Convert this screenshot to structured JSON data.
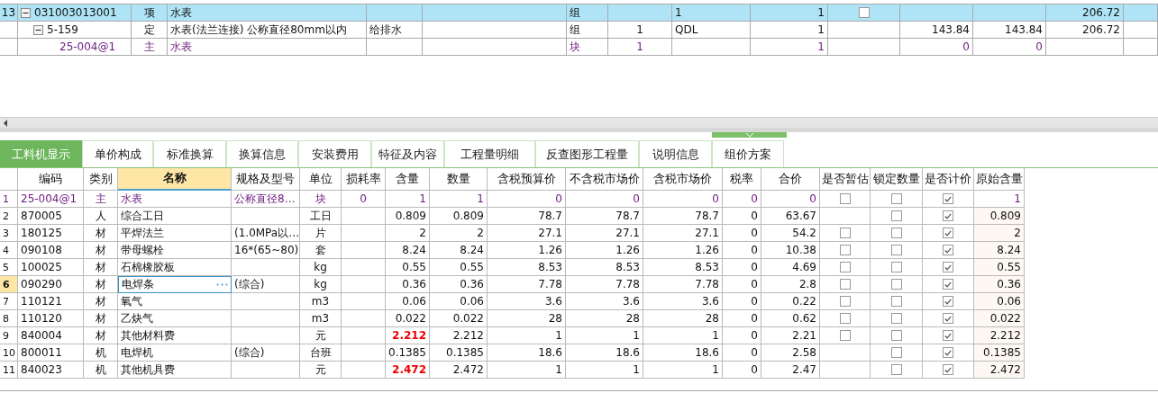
{
  "top_table": {
    "rows": [
      {
        "row_number": "13",
        "code": "031003013001",
        "type": "项",
        "name": "水表",
        "unit": "组",
        "column_9": "1",
        "column_10": "1",
        "column_11": false,
        "column_14": "206.72",
        "selected": true,
        "expanded": true,
        "children": [
          {
            "code": "5-159",
            "type": "定",
            "name": "水表(法兰连接) 公称直径80mm以内",
            "column_5": "给排水",
            "unit": "组",
            "column_8": "1",
            "column_9": "QDL",
            "column_10": "1",
            "column_12": "143.84",
            "column_13": "143.84",
            "column_14": "206.72",
            "selected": false,
            "expanded": true,
            "children": [
              {
                "code": "25-004@1",
                "type": "主",
                "name": "水表",
                "unit": "块",
                "column_8": "1",
                "column_10": "1",
                "column_12": "0",
                "column_13": "0",
                "kind": "main",
                "selected": false
              }
            ]
          }
        ]
      }
    ]
  },
  "tabs": [
    {
      "label": "工料机显示",
      "selected": true
    },
    {
      "label": "单价构成",
      "selected": false
    },
    {
      "label": "标准换算",
      "selected": false
    },
    {
      "label": "换算信息",
      "selected": false
    },
    {
      "label": "安装费用",
      "selected": false
    },
    {
      "label": "特征及内容",
      "selected": false
    },
    {
      "label": "工程量明细",
      "selected": false
    },
    {
      "label": "反查图形工程量",
      "selected": false
    },
    {
      "label": "说明信息",
      "selected": false
    },
    {
      "label": "组价方案",
      "selected": false
    }
  ],
  "resource_table": {
    "columns": [
      {
        "label": "编码",
        "selected": false
      },
      {
        "label": "类别",
        "selected": false
      },
      {
        "label": "名称",
        "selected": true
      },
      {
        "label": "规格及型号",
        "selected": false
      },
      {
        "label": "单位",
        "selected": false
      },
      {
        "label": "损耗率",
        "selected": false
      },
      {
        "label": "含量",
        "selected": false
      },
      {
        "label": "数量",
        "selected": false
      },
      {
        "label": "含税预算价",
        "selected": false
      },
      {
        "label": "不含税市场价",
        "selected": false
      },
      {
        "label": "含税市场价",
        "selected": false
      },
      {
        "label": "税率",
        "selected": false
      },
      {
        "label": "合价",
        "selected": false
      },
      {
        "label": "是否暂估",
        "selected": false
      },
      {
        "label": "锁定数量",
        "selected": false
      },
      {
        "label": "是否计价",
        "selected": false
      },
      {
        "label": "原始含量",
        "selected": false
      }
    ],
    "rows": [
      {
        "number": "1",
        "code": "25-004@1",
        "category": "主",
        "name": "水表",
        "spec": "公称直径8…",
        "unit": "块",
        "loss_rate": "0",
        "content": "1",
        "quantity": "1",
        "budget_price": "0",
        "market_price_ex_tax": "0",
        "market_price": "0",
        "tax_rate": "0",
        "total": "0",
        "provisional": false,
        "locked": false,
        "priced": true,
        "original_content": "1",
        "kind": "main",
        "content_highlight": false,
        "selected": false
      },
      {
        "number": "2",
        "code": "870005",
        "category": "人",
        "name": "综合工日",
        "unit": "工日",
        "content": "0.809",
        "quantity": "0.809",
        "budget_price": "78.7",
        "market_price_ex_tax": "78.7",
        "market_price": "78.7",
        "tax_rate": "0",
        "total": "63.67",
        "locked": false,
        "priced": true,
        "original_content": "0.809",
        "kind": "normal",
        "content_highlight": false,
        "selected": false
      },
      {
        "number": "3",
        "code": "180125",
        "category": "材",
        "name": "平焊法兰",
        "spec": "(1.0MPa以…",
        "unit": "片",
        "content": "2",
        "quantity": "2",
        "budget_price": "27.1",
        "market_price_ex_tax": "27.1",
        "market_price": "27.1",
        "tax_rate": "0",
        "total": "54.2",
        "provisional": false,
        "locked": false,
        "priced": true,
        "original_content": "2",
        "kind": "normal",
        "content_highlight": false,
        "selected": false
      },
      {
        "number": "4",
        "code": "090108",
        "category": "材",
        "name": "带母螺栓",
        "spec": "16*(65~80)",
        "unit": "套",
        "content": "8.24",
        "quantity": "8.24",
        "budget_price": "1.26",
        "market_price_ex_tax": "1.26",
        "market_price": "1.26",
        "tax_rate": "0",
        "total": "10.38",
        "provisional": false,
        "locked": false,
        "priced": true,
        "original_content": "8.24",
        "kind": "normal",
        "content_highlight": false,
        "selected": false
      },
      {
        "number": "5",
        "code": "100025",
        "category": "材",
        "name": "石棉橡胶板",
        "unit": "kg",
        "content": "0.55",
        "quantity": "0.55",
        "budget_price": "8.53",
        "market_price_ex_tax": "8.53",
        "market_price": "8.53",
        "tax_rate": "0",
        "total": "4.69",
        "provisional": false,
        "locked": false,
        "priced": true,
        "original_content": "0.55",
        "kind": "normal",
        "content_highlight": false,
        "selected": false
      },
      {
        "number": "6",
        "code": "090290",
        "category": "材",
        "name": "电焊条",
        "spec": "(综合)",
        "unit": "kg",
        "content": "0.36",
        "quantity": "0.36",
        "budget_price": "7.78",
        "market_price_ex_tax": "7.78",
        "market_price": "7.78",
        "tax_rate": "0",
        "total": "2.8",
        "provisional": false,
        "locked": false,
        "priced": true,
        "original_content": "0.36",
        "kind": "normal",
        "content_highlight": false,
        "selected": true
      },
      {
        "number": "7",
        "code": "110121",
        "category": "材",
        "name": "氧气",
        "unit": "m3",
        "content": "0.06",
        "quantity": "0.06",
        "budget_price": "3.6",
        "market_price_ex_tax": "3.6",
        "market_price": "3.6",
        "tax_rate": "0",
        "total": "0.22",
        "provisional": false,
        "locked": false,
        "priced": true,
        "original_content": "0.06",
        "kind": "normal",
        "content_highlight": false,
        "selected": false
      },
      {
        "number": "8",
        "code": "110120",
        "category": "材",
        "name": "乙炔气",
        "unit": "m3",
        "content": "0.022",
        "quantity": "0.022",
        "budget_price": "28",
        "market_price_ex_tax": "28",
        "market_price": "28",
        "tax_rate": "0",
        "total": "0.62",
        "provisional": false,
        "locked": false,
        "priced": true,
        "original_content": "0.022",
        "kind": "normal",
        "content_highlight": false,
        "selected": false
      },
      {
        "number": "9",
        "code": "840004",
        "category": "材",
        "name": "其他材料费",
        "unit": "元",
        "content": "2.212",
        "quantity": "2.212",
        "budget_price": "1",
        "market_price_ex_tax": "1",
        "market_price": "1",
        "tax_rate": "0",
        "total": "2.21",
        "provisional": false,
        "locked": false,
        "priced": true,
        "original_content": "2.212",
        "kind": "normal",
        "content_highlight": true,
        "selected": false
      },
      {
        "number": "10",
        "code": "800011",
        "category": "机",
        "name": "电焊机",
        "spec": "(综合)",
        "unit": "台班",
        "content": "0.1385",
        "quantity": "0.1385",
        "budget_price": "18.6",
        "market_price_ex_tax": "18.6",
        "market_price": "18.6",
        "tax_rate": "0",
        "total": "2.58",
        "locked": false,
        "priced": true,
        "original_content": "0.1385",
        "kind": "normal",
        "content_highlight": false,
        "selected": false
      },
      {
        "number": "11",
        "code": "840023",
        "category": "机",
        "name": "其他机具费",
        "unit": "元",
        "content": "2.472",
        "quantity": "2.472",
        "budget_price": "1",
        "market_price_ex_tax": "1",
        "market_price": "1",
        "tax_rate": "0",
        "total": "2.47",
        "locked": false,
        "priced": true,
        "original_content": "2.472",
        "kind": "normal",
        "content_highlight": true,
        "selected": false
      }
    ]
  }
}
